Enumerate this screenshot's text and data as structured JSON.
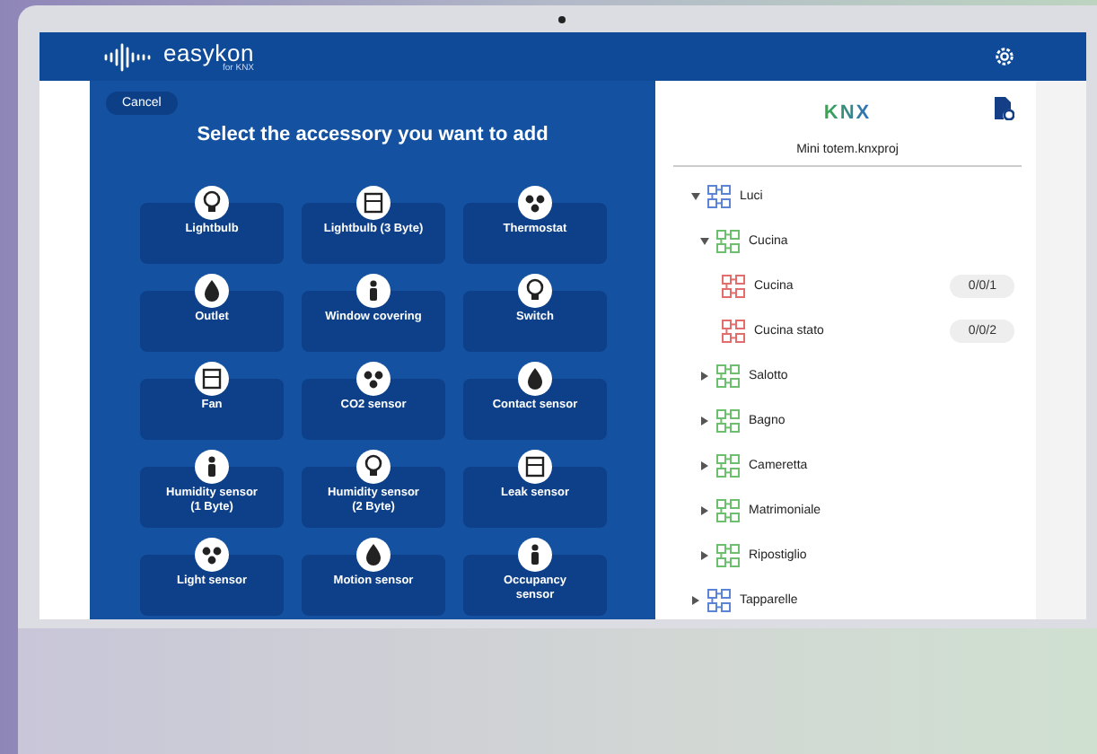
{
  "header": {
    "logo_text": "easykon",
    "logo_subtext": "for KNX"
  },
  "accessory_panel": {
    "cancel_button": "Cancel",
    "title": "Select the accessory you want to add",
    "accessories": [
      {
        "label": "Lightbulb"
      },
      {
        "label": "Lightbulb (3 Byte)"
      },
      {
        "label": "Thermostat"
      },
      {
        "label": "Outlet"
      },
      {
        "label": "Window covering"
      },
      {
        "label": "Switch"
      },
      {
        "label": "Fan"
      },
      {
        "label": "CO2 sensor"
      },
      {
        "label": "Contact sensor"
      },
      {
        "label": "Humidity sensor\n(1 Byte)"
      },
      {
        "label": "Humidity sensor\n(2 Byte)"
      },
      {
        "label": "Leak sensor"
      },
      {
        "label": "Light sensor"
      },
      {
        "label": "Motion sensor"
      },
      {
        "label": "Occupancy\nsensor"
      }
    ]
  },
  "project_panel": {
    "logo": "KNX",
    "project_name": "Mini totem.knxproj",
    "tree": [
      {
        "label": "Luci",
        "expanded": true,
        "children": [
          {
            "label": "Cucina",
            "expanded": true,
            "children": [
              {
                "label": "Cucina",
                "address": "0/0/1"
              },
              {
                "label": "Cucina stato",
                "address": "0/0/2"
              }
            ]
          },
          {
            "label": "Salotto",
            "expanded": false
          },
          {
            "label": "Bagno",
            "expanded": false
          },
          {
            "label": "Cameretta",
            "expanded": false
          },
          {
            "label": "Matrimoniale",
            "expanded": false
          },
          {
            "label": "Ripostiglio",
            "expanded": false
          }
        ]
      },
      {
        "label": "Tapparelle",
        "expanded": false
      }
    ]
  }
}
